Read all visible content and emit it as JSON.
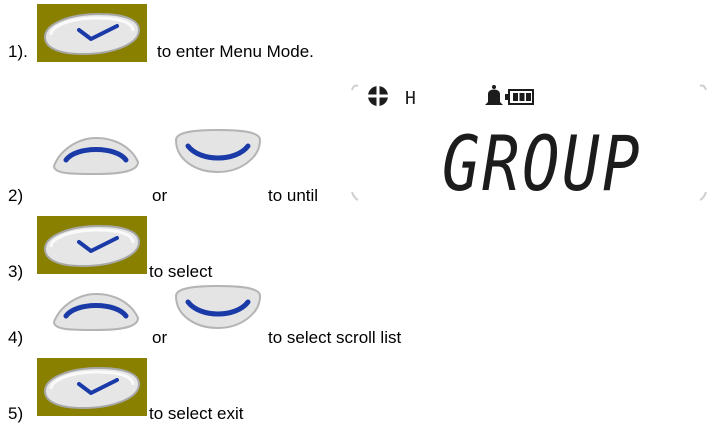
{
  "steps": [
    {
      "number": "1).",
      "text1": "to enter Menu Mode."
    },
    {
      "number": "2)",
      "or": "or",
      "text": "to until"
    },
    {
      "number": "3)",
      "text": "to select"
    },
    {
      "number": "4)",
      "or": "or",
      "text": "to select scroll list"
    },
    {
      "number": "5)",
      "text": "to select exit"
    }
  ],
  "lcd": {
    "indicator": "H",
    "display_text": "GROUP"
  },
  "colors": {
    "olive_bg": "#8a8000",
    "button_face": "#dcdcdc",
    "accent_blue": "#1a3aa8",
    "lcd_text": "#1c1c1c"
  },
  "icons": {
    "confirm_button": "check-icon",
    "up_button": "arc-up-icon",
    "down_button": "arc-down-icon",
    "crosshair": "crosshair-icon",
    "alarm": "bell-icon",
    "battery": "battery-icon"
  }
}
